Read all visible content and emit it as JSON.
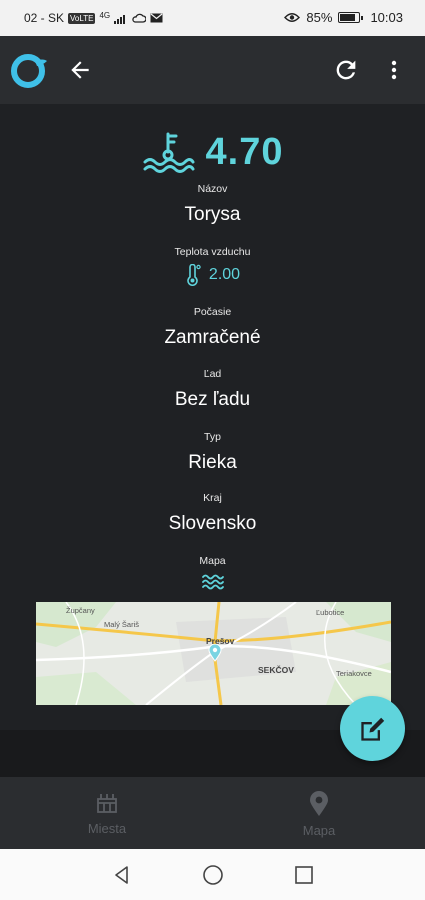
{
  "status_bar": {
    "carrier": "02 - SK",
    "volte": "VoLTE",
    "network": "4G",
    "battery_percent": "85%",
    "battery_level": 0.85,
    "time": "10:03"
  },
  "app_bar": {
    "logo_icon": "brand-logo-icon",
    "back_icon": "arrow-back-icon",
    "refresh_icon": "refresh-icon",
    "more_icon": "more-vert-icon"
  },
  "detail": {
    "water_level": "4.70",
    "level_icon": "water-gauge-icon",
    "name_label": "Názov",
    "name_value": "Torysa",
    "air_temp_label": "Teplota vzduchu",
    "air_temp_value": "2.00",
    "weather_label": "Počasie",
    "weather_value": "Zamračené",
    "ice_label": "Ľad",
    "ice_value": "Bez ľadu",
    "type_label": "Typ",
    "type_value": "Rieka",
    "region_label": "Kraj",
    "region_value": "Slovensko",
    "map_label": "Mapa",
    "map_icon": "water-waves-icon"
  },
  "map": {
    "places": [
      "Župčany",
      "Malý Šariš",
      "Prešov",
      "Ľubotice",
      "SEKČOV",
      "Teriakovce"
    ]
  },
  "fab": {
    "icon": "edit-icon"
  },
  "bottom_nav": {
    "items": [
      {
        "label": "Miesta",
        "icon": "places-icon"
      },
      {
        "label": "Mapa",
        "icon": "map-pin-icon"
      }
    ]
  },
  "system_nav": {
    "back_icon": "nav-back-icon",
    "home_icon": "nav-home-icon",
    "recents_icon": "nav-recents-icon"
  },
  "colors": {
    "accent": "#5fd4dc",
    "background": "#1f2124",
    "app_bar": "#2b2d30",
    "nav_inactive": "#5b5e63"
  }
}
